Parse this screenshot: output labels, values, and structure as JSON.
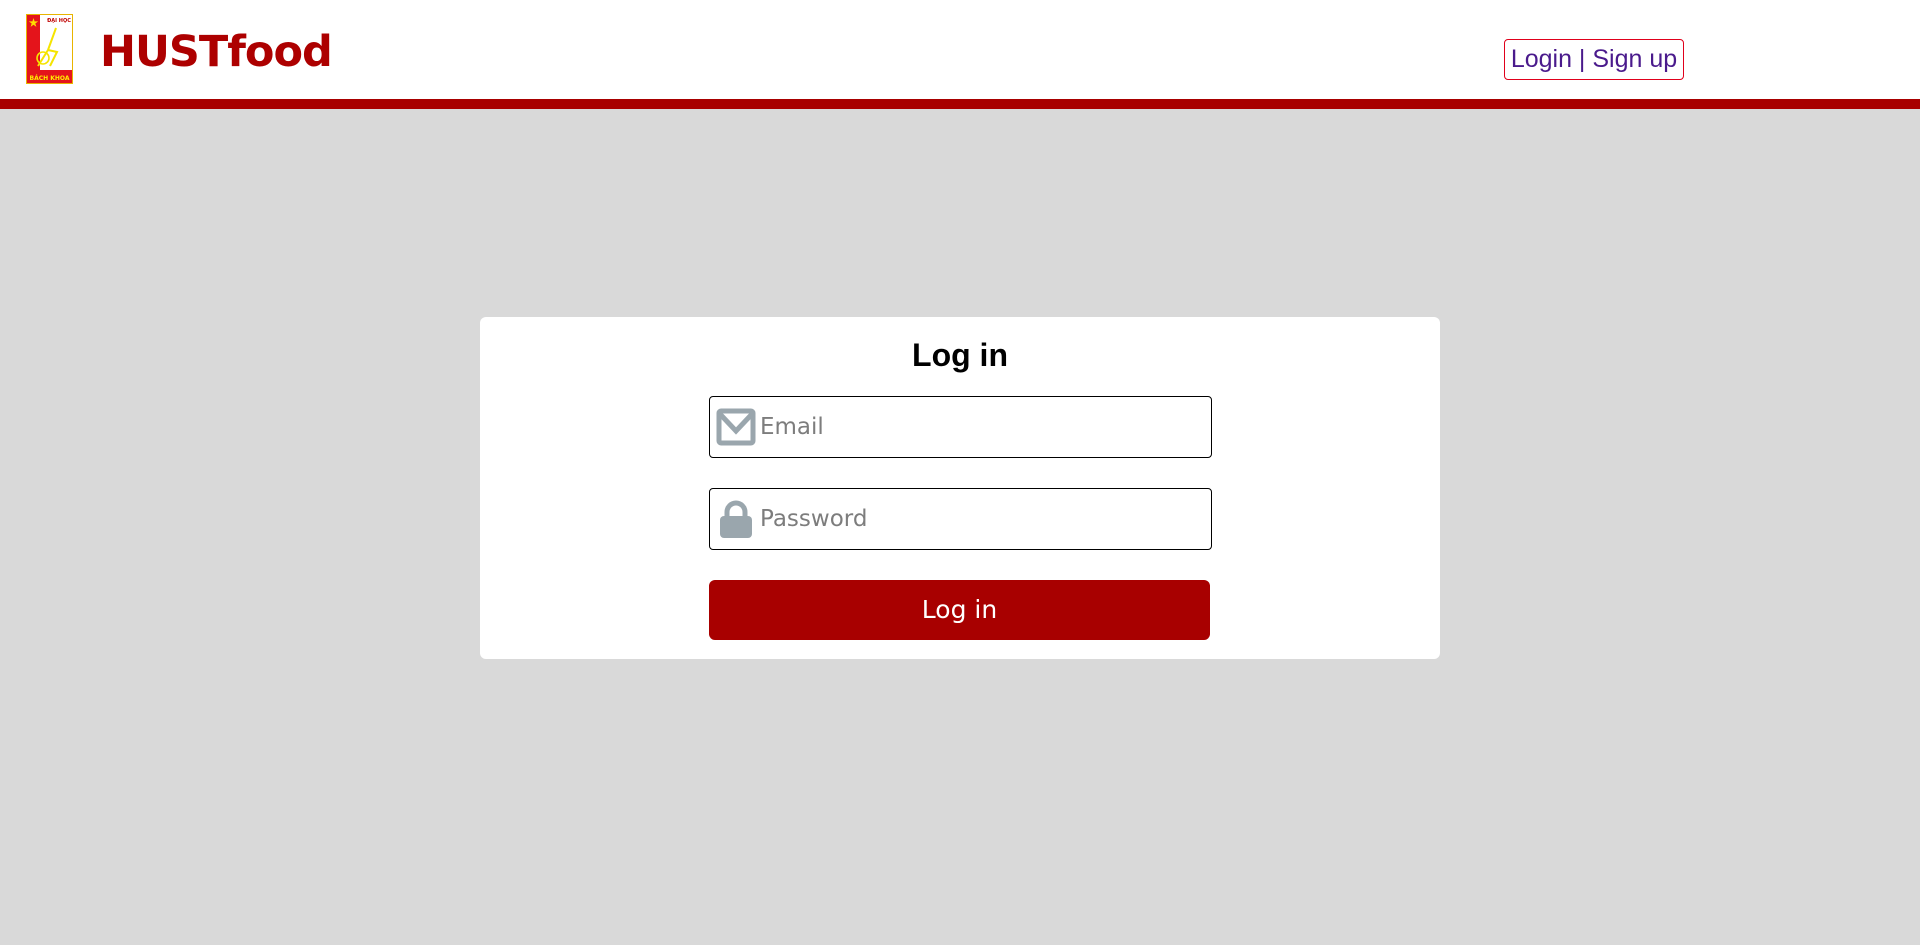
{
  "header": {
    "logo": {
      "icon": "bach-khoa-logo-icon",
      "top_text": "ĐẠI HỌC",
      "bottom_text": "BÁCH KHOA"
    },
    "brand": "HUSTfood",
    "auth_link": "Login | Sign up"
  },
  "login_form": {
    "title": "Log in",
    "email": {
      "icon": "envelope-icon",
      "placeholder": "Email",
      "value": ""
    },
    "password": {
      "icon": "lock-icon",
      "placeholder": "Password",
      "value": ""
    },
    "submit_label": "Log in"
  },
  "colors": {
    "brand_red": "#a80000",
    "page_background": "#d9d9d9",
    "card_background": "#ffffff",
    "link_text": "#4a1a8c",
    "link_border": "#e0001b",
    "icon_gray": "#9aa6ad"
  }
}
